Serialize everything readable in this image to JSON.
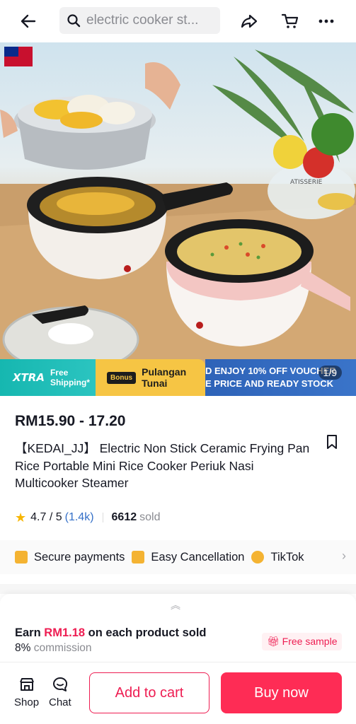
{
  "header": {
    "search_placeholder": "electric cooker st..."
  },
  "hero": {
    "xtra_logo": "XTRA",
    "xtra_text_1": "Free",
    "xtra_text_2": "Shipping*",
    "bonus_chip": "Bonus",
    "bonus_text_1": "Pulangan",
    "bonus_text_2": "Tunai",
    "banner_line_1": "D ENJOY 10% OFF VOUCHER",
    "banner_line_2": "E PRICE AND READY STOCK",
    "image_counter": "1/9",
    "seal_text": "ATISSERIE"
  },
  "product": {
    "price": "RM15.90 - 17.20",
    "title": "【KEDAI_JJ】 Electric Non Stick Ceramic Frying Pan Rice Portable Mini Rice Cooker Periuk Nasi Multicooker Steamer",
    "rating": "4.7 / 5",
    "reviews": "(1.4k)",
    "sold_count": "6612",
    "sold_label": "sold"
  },
  "guarantees": [
    {
      "label": "Secure payments",
      "icon": "card-icon"
    },
    {
      "label": "Easy Cancellation",
      "icon": "cancel-icon"
    },
    {
      "label": "TikTok",
      "icon": "check-badge-icon"
    }
  ],
  "affiliate": {
    "earn_prefix": "Earn",
    "earn_amount": "RM1.18",
    "earn_suffix": "on each product sold",
    "commission_pct": "8%",
    "commission_label": "commission",
    "free_sample": "Free sample"
  },
  "bottom_bar": {
    "shop_label": "Shop",
    "chat_label": "Chat",
    "add_to_cart": "Add to cart",
    "buy_now": "Buy now"
  },
  "colors": {
    "accent": "#fe2c55",
    "accent_text": "#ee1d52",
    "rating_star": "#f7b500",
    "link": "#3570c8"
  }
}
